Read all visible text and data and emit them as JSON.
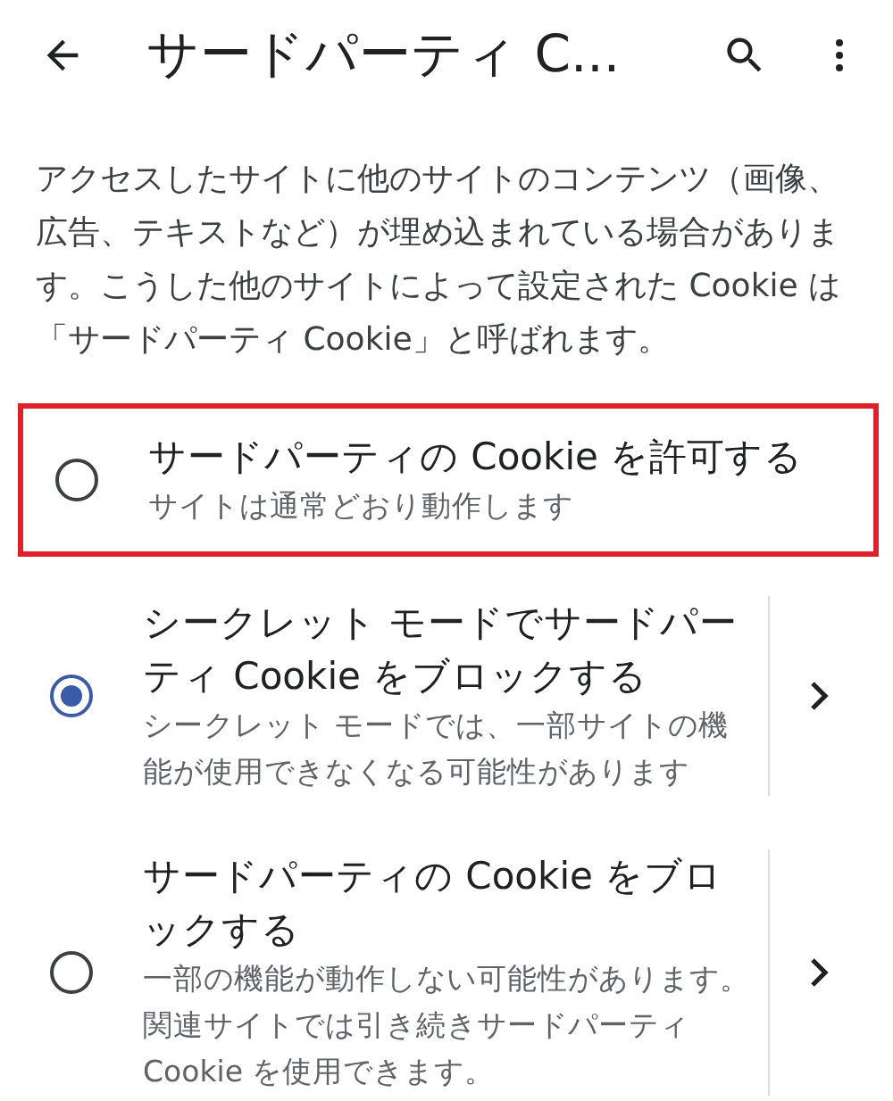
{
  "app_bar": {
    "title": "サードパーティ C..."
  },
  "description": "アクセスしたサイトに他のサイトのコンテンツ（画像、広告、テキストなど）が埋め込まれている場合があります。こうした他のサイトによって設定された Cookie は「サードパーティ Cookie」と呼ばれます。",
  "options": [
    {
      "title": "サードパーティの Cookie を許可する",
      "subtitle": "サイトは通常どおり動作します",
      "selected": false,
      "has_details": false,
      "highlighted": true
    },
    {
      "title": "シークレット モードでサードパーティ Cookie をブロックする",
      "subtitle": "シークレット モードでは、一部サイトの機能が使用できなくなる可能性があります",
      "selected": true,
      "has_details": true,
      "highlighted": false
    },
    {
      "title": "サードパーティの Cookie をブロックする",
      "subtitle": "一部の機能が動作しない可能性があります。関連サイトでは引き続きサードパーティ Cookie を使用できます。",
      "selected": false,
      "has_details": true,
      "highlighted": false
    }
  ]
}
